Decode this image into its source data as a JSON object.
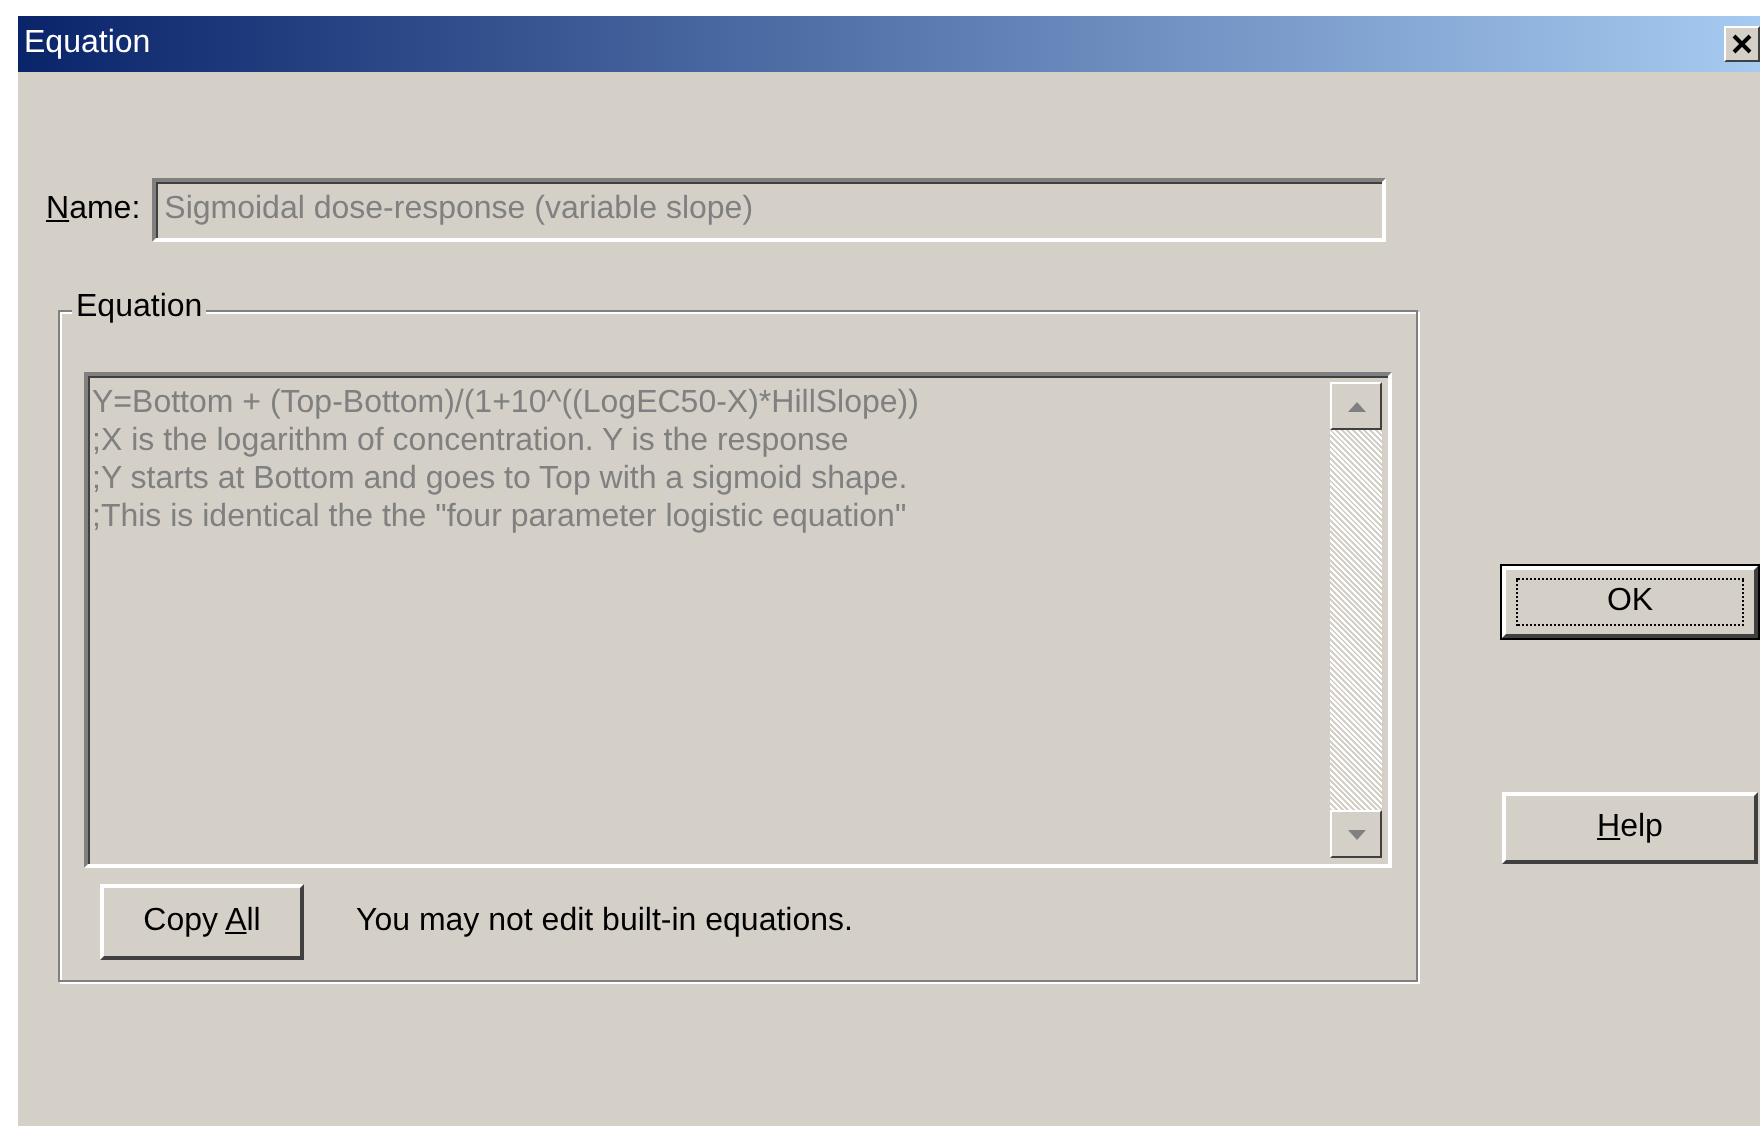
{
  "window": {
    "title": "Equation"
  },
  "name_field": {
    "label": {
      "key": "N",
      "after": "ame:"
    },
    "value": "Sigmoidal dose-response (variable slope)",
    "disabled": true
  },
  "equation_group": {
    "title": "Equation",
    "disabled": true,
    "lines": [
      "Y=Bottom + (Top-Bottom)/(1+10^((LogEC50-X)*HillSlope))",
      ";X is the logarithm of concentration. Y is the response",
      ";Y starts at Bottom and goes to Top with a sigmoid shape.",
      ";This is identical the the \"four parameter logistic equation\""
    ],
    "copy_button": {
      "before": "Copy ",
      "key": "A",
      "after": "ll"
    },
    "note": "You may not edit built-in equations."
  },
  "buttons": [
    {
      "after": "OK",
      "default": true
    },
    {
      "key": "H",
      "after": "elp",
      "default": false
    }
  ]
}
